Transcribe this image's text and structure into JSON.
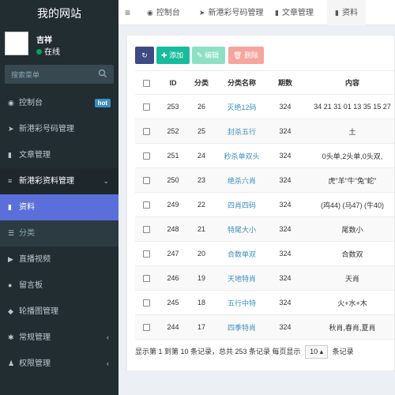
{
  "brand": "我的网站",
  "user": {
    "name": "吉祥",
    "status": "在线"
  },
  "search": {
    "placeholder": "搜索菜单"
  },
  "menu": [
    {
      "icon": "dashboard-icon",
      "glyph": "◉",
      "label": "控制台",
      "badge": "hot"
    },
    {
      "icon": "send-icon",
      "glyph": "➤",
      "label": "新港彩号码管理"
    },
    {
      "icon": "bookmark-icon",
      "glyph": "▮",
      "label": "文章管理"
    },
    {
      "icon": "list-icon",
      "glyph": "≡",
      "label": "新港彩资料管理"
    },
    {
      "icon": "bookmark-icon",
      "glyph": "▮",
      "label": "资料"
    },
    {
      "icon": "list-icon",
      "glyph": "☰",
      "label": "分类"
    },
    {
      "icon": "video-icon",
      "glyph": "▶",
      "label": "直播视频"
    },
    {
      "icon": "comment-icon",
      "glyph": "●",
      "label": "留言板"
    },
    {
      "icon": "leaf-icon",
      "glyph": "◆",
      "label": "轮播图管理"
    },
    {
      "icon": "gears-icon",
      "glyph": "✱",
      "label": "常规管理"
    },
    {
      "icon": "users-icon",
      "glyph": "♟",
      "label": "权限管理"
    }
  ],
  "tabs": [
    {
      "label": "控制台",
      "glyph": "◉"
    },
    {
      "label": "新港彩号码管理",
      "glyph": "➤"
    },
    {
      "label": "文章管理",
      "glyph": "▮"
    },
    {
      "label": "资料",
      "glyph": "▮"
    }
  ],
  "toolbar": {
    "add": "添加",
    "edit": "编辑",
    "delete": "删除"
  },
  "table": {
    "headers": [
      "ID",
      "分类",
      "分类名称",
      "期数",
      "内容"
    ],
    "rows": [
      [
        "253",
        "26",
        "灭绝12码",
        "324",
        "34 21 31 01 13 35 15 27"
      ],
      [
        "252",
        "25",
        "封杀五行",
        "324",
        "土"
      ],
      [
        "251",
        "24",
        "秒杀单双头",
        "324",
        "0头单,2头单,0头双,"
      ],
      [
        "250",
        "23",
        "绝杀六肖",
        "324",
        "虎\"羊\"牛\"兔\"蛇\""
      ],
      [
        "249",
        "22",
        "四肖四码",
        "324",
        "(鸡44) (马47) (牛40)"
      ],
      [
        "248",
        "21",
        "特尾大小",
        "324",
        "尾数小"
      ],
      [
        "247",
        "20",
        "合数单双",
        "324",
        "合数双"
      ],
      [
        "246",
        "19",
        "天地特肖",
        "324",
        "天肖"
      ],
      [
        "245",
        "18",
        "五行中特",
        "324",
        "火+水+木"
      ],
      [
        "244",
        "17",
        "四季特肖",
        "324",
        "秋肖,春肖,夏肖"
      ]
    ]
  },
  "pager": {
    "text": "显示第 1 到第 10 条记录，总共 253 条记录 每页显示",
    "per_page": "10",
    "suffix": "条记录"
  }
}
